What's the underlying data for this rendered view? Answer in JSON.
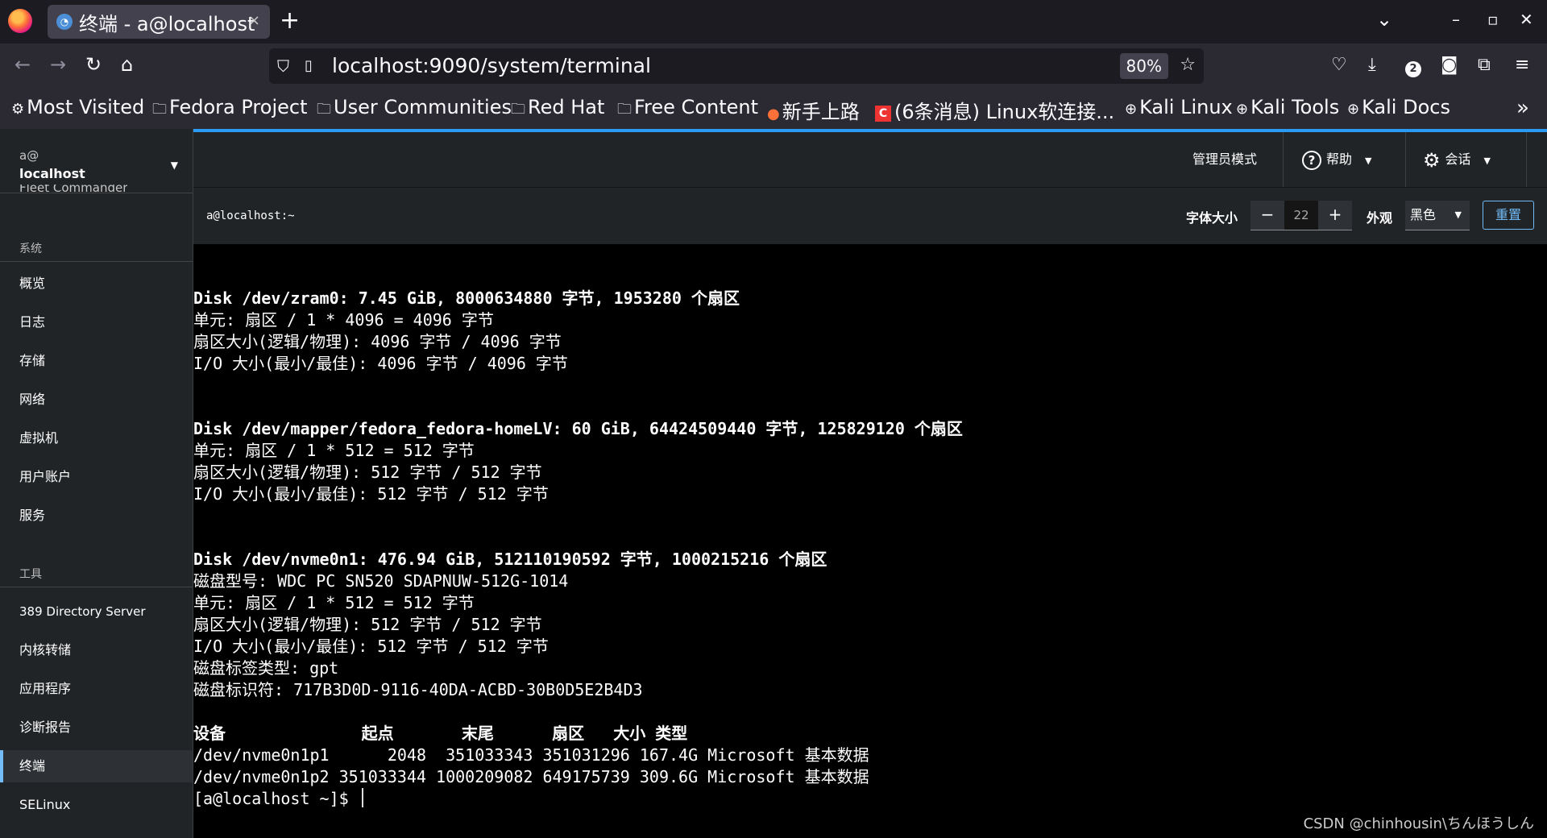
{
  "browser": {
    "tab_title": "终端 - a@localhost",
    "tab_close": "×",
    "new_tab": "+",
    "win_list": "⌄",
    "win_min": "–",
    "win_max": "▫",
    "win_close": "✕",
    "url": "localhost:9090/system/terminal",
    "zoom": "80%",
    "extension_badge": "2",
    "bookmarks": [
      {
        "label": "Most Visited",
        "icon": "gear-icon"
      },
      {
        "label": "Fedora Project",
        "icon": "folder-icon"
      },
      {
        "label": "User Communities",
        "icon": "folder-icon"
      },
      {
        "label": "Red Hat",
        "icon": "folder-icon"
      },
      {
        "label": "Free Content",
        "icon": "folder-icon"
      },
      {
        "label": "新手上路",
        "icon": "firefox-icon"
      },
      {
        "label": "(6条消息) Linux软连接...",
        "icon": "csdn-icon",
        "icon_text": "C"
      },
      {
        "label": "Kali Linux",
        "icon": "globe-icon"
      },
      {
        "label": "Kali Tools",
        "icon": "globe-icon"
      },
      {
        "label": "Kali Docs",
        "icon": "globe-icon"
      }
    ]
  },
  "cockpit": {
    "host": {
      "user": "a@",
      "name": "localhost",
      "cut_item": "Fleet Commander"
    },
    "sidebar": {
      "system_title": "系统",
      "system_items": [
        "概览",
        "日志",
        "存储",
        "网络",
        "虚拟机",
        "用户账户",
        "服务"
      ],
      "tools_title": "工具",
      "tools_items": [
        "389 Directory Server",
        "内核转储",
        "应用程序",
        "诊断报告",
        "终端",
        "SELinux"
      ],
      "active": "终端"
    },
    "topbar": {
      "admin": "管理员模式",
      "help": "帮助",
      "session": "会话"
    },
    "terminal_header": {
      "crumb": "a@localhost:~",
      "font_size_label": "字体大小",
      "font_size_value": "22",
      "minus": "−",
      "plus": "+",
      "appearance_label": "外观",
      "theme": "黑色",
      "reset": "重置"
    },
    "terminal_lines": [
      {
        "text": "",
        "bold": false
      },
      {
        "text": "",
        "bold": false
      },
      {
        "text": "Disk /dev/zram0: 7.45 GiB, 8000634880 字节, 1953280 个扇区",
        "bold": true
      },
      {
        "text": "单元: 扇区 / 1 * 4096 = 4096 字节",
        "bold": false
      },
      {
        "text": "扇区大小(逻辑/物理): 4096 字节 / 4096 字节",
        "bold": false
      },
      {
        "text": "I/O 大小(最小/最佳): 4096 字节 / 4096 字节",
        "bold": false
      },
      {
        "text": "",
        "bold": false
      },
      {
        "text": "",
        "bold": false
      },
      {
        "text": "Disk /dev/mapper/fedora_fedora-homeLV: 60 GiB, 64424509440 字节, 125829120 个扇区",
        "bold": true
      },
      {
        "text": "单元: 扇区 / 1 * 512 = 512 字节",
        "bold": false
      },
      {
        "text": "扇区大小(逻辑/物理): 512 字节 / 512 字节",
        "bold": false
      },
      {
        "text": "I/O 大小(最小/最佳): 512 字节 / 512 字节",
        "bold": false
      },
      {
        "text": "",
        "bold": false
      },
      {
        "text": "",
        "bold": false
      },
      {
        "text": "Disk /dev/nvme0n1: 476.94 GiB, 512110190592 字节, 1000215216 个扇区",
        "bold": true
      },
      {
        "text": "磁盘型号: WDC PC SN520 SDAPNUW-512G-1014",
        "bold": false
      },
      {
        "text": "单元: 扇区 / 1 * 512 = 512 字节",
        "bold": false
      },
      {
        "text": "扇区大小(逻辑/物理): 512 字节 / 512 字节",
        "bold": false
      },
      {
        "text": "I/O 大小(最小/最佳): 512 字节 / 512 字节",
        "bold": false
      },
      {
        "text": "磁盘标签类型: gpt",
        "bold": false
      },
      {
        "text": "磁盘标识符: 717B3D0D-9116-40DA-ACBD-30B0D5E2B4D3",
        "bold": false
      },
      {
        "text": "",
        "bold": false
      },
      {
        "text": "设备              起点       末尾      扇区   大小 类型",
        "bold": true
      },
      {
        "text": "/dev/nvme0n1p1      2048  351033343 351031296 167.4G Microsoft 基本数据",
        "bold": false
      },
      {
        "text": "/dev/nvme0n1p2 351033344 1000209082 649175739 309.6G Microsoft 基本数据",
        "bold": false
      }
    ],
    "prompt": "[a@localhost ~]$ ",
    "watermark": "CSDN @chinhousin\\ちんほうしん"
  }
}
